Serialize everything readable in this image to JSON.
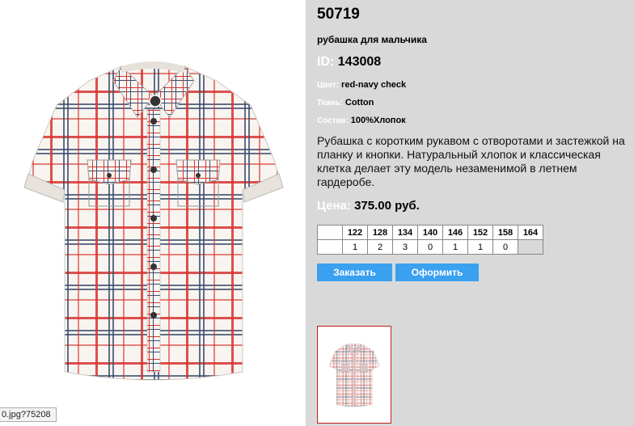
{
  "product": {
    "code": "50719",
    "subtitle": "рубашка для мальчика",
    "id_label": "ID:",
    "id_value": "143008",
    "color_label": "Цвет:",
    "color_value": "red-navy check",
    "fabric_label": "Ткань:",
    "fabric_value": "Cotton",
    "composition_label": "Состав:",
    "composition_value": "100%Хлопок",
    "description": "Рубашка с коротким рукавом с отворотами и застежкой на планку и кнопки. Натуральный хлопок и классическая клетка делает эту модель незаменимой в летнем гардеробе.",
    "price_label": "Цена:",
    "price_value": "375.00 руб."
  },
  "sizes": {
    "headers": [
      "122",
      "128",
      "134",
      "140",
      "146",
      "152",
      "158",
      "164"
    ],
    "quantities": [
      "1",
      "2",
      "3",
      "0",
      "1",
      "1",
      "0",
      ""
    ]
  },
  "buttons": {
    "order": "Заказать",
    "checkout": "Оформить"
  },
  "status_tip": "0.jpg?75208",
  "colors": {
    "panel": "#d9d9d9",
    "button": "#3aa0f0",
    "thumb_border": "#c0201e",
    "check_red": "#d8332f",
    "check_navy": "#3a4c6e"
  }
}
